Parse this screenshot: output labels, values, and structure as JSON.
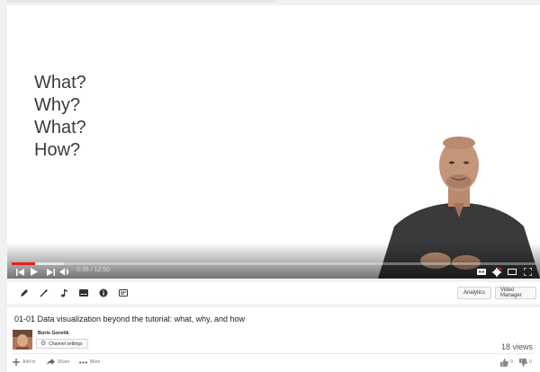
{
  "player": {
    "slide_lines": [
      "What?",
      "Why?",
      "What?",
      "How?"
    ],
    "current_time": "0:35",
    "time_separator": "/",
    "duration": "12:50",
    "progress_fraction": 0.045,
    "buffered_fraction": 0.1,
    "progress_color": "#e62117"
  },
  "toolbar": {
    "icons": [
      "pencil-icon",
      "magic-wand-icon",
      "music-note-icon",
      "subtitles-icon",
      "info-icon",
      "annotations-icon"
    ],
    "analytics_label": "Analytics",
    "video_manager_label": "Video Manager"
  },
  "video": {
    "title": "01-01 Data visualization beyond the tutorial: what, why, and how",
    "channel_name": "Boris Gorelik",
    "channel_settings_label": "Channel settings",
    "views": "18 views",
    "add_to_label": "Add to",
    "share_label": "Share",
    "more_label": "More",
    "likes": "0",
    "dislikes": "0"
  }
}
